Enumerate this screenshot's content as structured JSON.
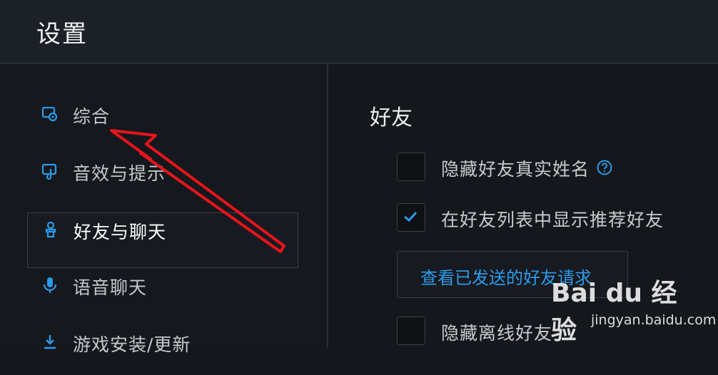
{
  "window": {
    "title": "设置"
  },
  "sidebar": {
    "items": [
      {
        "label": "综合",
        "icon": "general-settings-icon"
      },
      {
        "label": "音效与提示",
        "icon": "sound-icon"
      },
      {
        "label": "好友与聊天",
        "icon": "friends-icon",
        "active": true
      },
      {
        "label": "语音聊天",
        "icon": "microphone-icon"
      },
      {
        "label": "游戏安装/更新",
        "icon": "download-icon"
      }
    ]
  },
  "main": {
    "section_title": "好友",
    "options": [
      {
        "label": "隐藏好友真实姓名",
        "checked": false,
        "help_icon": "help-icon"
      },
      {
        "label": "在好友列表中显示推荐好友",
        "checked": true
      },
      {
        "label": "隐藏离线好友",
        "checked": false
      }
    ],
    "view_requests_button": "查看已发送的好友请求"
  },
  "watermark": {
    "brand": "Bai du 经验",
    "url": "jingyan.baidu.com"
  },
  "colors": {
    "accent": "#2b9be8",
    "annotation_arrow": "#e8141c",
    "background": "#14171c"
  }
}
